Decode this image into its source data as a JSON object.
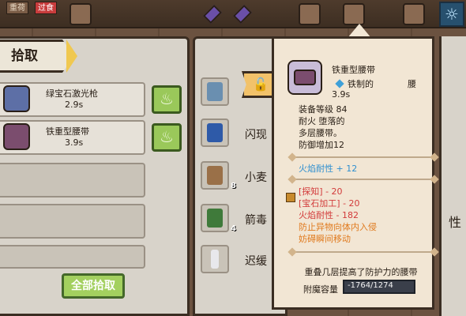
{
  "top_bar": {
    "tabs": [
      "重荷",
      "过食"
    ]
  },
  "pickup_panel": {
    "title": "拾取",
    "items": [
      {
        "name": "绿宝石激光枪",
        "weight": "2.9s",
        "icon": "laser-gun-icon"
      },
      {
        "name": "铁重型腰带",
        "weight": "3.9s",
        "icon": "belt-icon"
      }
    ],
    "pickup_all_label": "全部拾取"
  },
  "inventory_panel": {
    "items": [
      {
        "label": "",
        "icon": "stethoscope-icon",
        "count": ""
      },
      {
        "label": "闪现",
        "icon": "book-icon",
        "count": ""
      },
      {
        "label": "小麦",
        "icon": "wheat-bundle-icon",
        "count": "8"
      },
      {
        "label": "箭毒",
        "icon": "herb-icon",
        "count": "4"
      },
      {
        "label": "迟缓",
        "icon": "vial-icon",
        "count": ""
      }
    ]
  },
  "right_strip": {
    "letters": [
      "性"
    ]
  },
  "tooltip": {
    "name": "铁重型腰带",
    "quality_prefix": "铁制的",
    "quality_suffix": "腰",
    "weight": "3.9s",
    "lines": [
      "装备等级 84",
      "耐火 堕落的",
      "多层腰带。",
      "防御增加12"
    ],
    "buff": "火焰耐性 + 12",
    "debuffs": [
      "[探知] - 20",
      "[宝石加工] - 20",
      "火焰耐性 - 182"
    ],
    "notes": [
      "防止异物向体内入侵",
      "妨碍瞬间移动"
    ],
    "description": "重叠几层提高了防护力的腰带",
    "enchant_label": "附魔容量",
    "enchant_value": "-1764/1274",
    "enchant_fill": 0
  },
  "colors": {
    "buff": "#2f8fd0",
    "debuff": "#d23a3a",
    "note": "#e07a1e",
    "pickup_button": "#a3d05f"
  }
}
